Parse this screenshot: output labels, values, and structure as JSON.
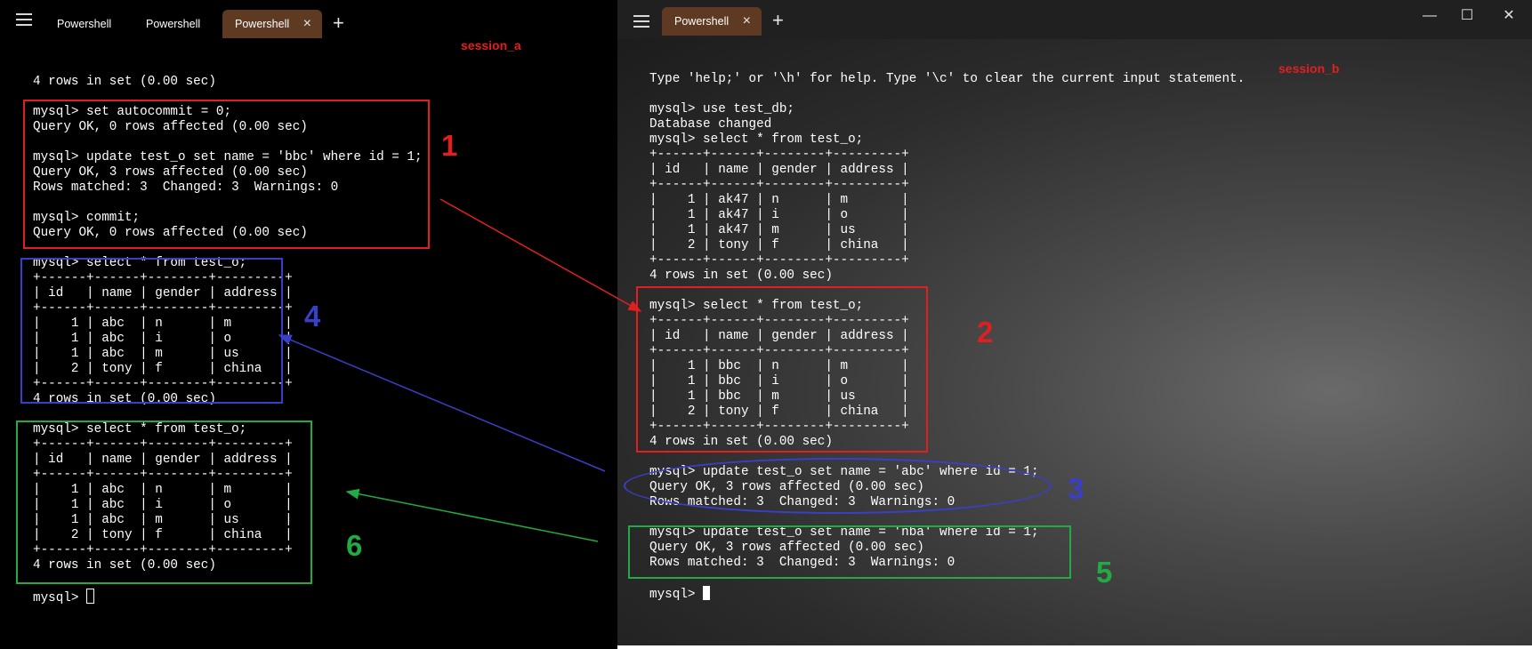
{
  "session_a": {
    "tabs": [
      {
        "label": "Powershell",
        "active": false
      },
      {
        "label": "Powershell",
        "active": false
      },
      {
        "label": "Powershell",
        "active": true
      }
    ],
    "tab_close_icon": "×",
    "new_tab_icon": "+",
    "session_label": "session_a",
    "terminal_lines": [
      "4 rows in set (0.00 sec)",
      "",
      "mysql> set autocommit = 0;",
      "Query OK, 0 rows affected (0.00 sec)",
      "",
      "mysql> update test_o set name = 'bbc' where id = 1;",
      "Query OK, 3 rows affected (0.00 sec)",
      "Rows matched: 3  Changed: 3  Warnings: 0",
      "",
      "mysql> commit;",
      "Query OK, 0 rows affected (0.00 sec)",
      "",
      "mysql> select * from test_o;",
      "+------+------+--------+---------+",
      "| id   | name | gender | address |",
      "+------+------+--------+---------+",
      "|    1 | abc  | n      | m       |",
      "|    1 | abc  | i      | o       |",
      "|    1 | abc  | m      | us      |",
      "|    2 | tony | f      | china   |",
      "+------+------+--------+---------+",
      "4 rows in set (0.00 sec)",
      "",
      "mysql> select * from test_o;",
      "+------+------+--------+---------+",
      "| id   | name | gender | address |",
      "+------+------+--------+---------+",
      "|    1 | abc  | n      | m       |",
      "|    1 | abc  | i      | o       |",
      "|    1 | abc  | m      | us      |",
      "|    2 | tony | f      | china   |",
      "+------+------+--------+---------+",
      "4 rows in set (0.00 sec)",
      "",
      "mysql> "
    ]
  },
  "session_b": {
    "tabs": [
      {
        "label": "Powershell",
        "active": true
      }
    ],
    "tab_close_icon": "×",
    "new_tab_icon": "+",
    "window_controls": {
      "minimize": "—",
      "maximize": "☐",
      "close": "✕"
    },
    "session_label": "session_b",
    "terminal_lines": [
      "Type 'help;' or '\\h' for help. Type '\\c' to clear the current input statement.",
      "",
      "mysql> use test_db;",
      "Database changed",
      "mysql> select * from test_o;",
      "+------+------+--------+---------+",
      "| id   | name | gender | address |",
      "+------+------+--------+---------+",
      "|    1 | ak47 | n      | m       |",
      "|    1 | ak47 | i      | o       |",
      "|    1 | ak47 | m      | us      |",
      "|    2 | tony | f      | china   |",
      "+------+------+--------+---------+",
      "4 rows in set (0.00 sec)",
      "",
      "mysql> select * from test_o;",
      "+------+------+--------+---------+",
      "| id   | name | gender | address |",
      "+------+------+--------+---------+",
      "|    1 | bbc  | n      | m       |",
      "|    1 | bbc  | i      | o       |",
      "|    1 | bbc  | m      | us      |",
      "|    2 | tony | f      | china   |",
      "+------+------+--------+---------+",
      "4 rows in set (0.00 sec)",
      "",
      "mysql> update test_o set name = 'abc' where id = 1;",
      "Query OK, 3 rows affected (0.00 sec)",
      "Rows matched: 3  Changed: 3  Warnings: 0",
      "",
      "mysql> update test_o set name = 'nba' where id = 1;",
      "Query OK, 3 rows affected (0.00 sec)",
      "Rows matched: 3  Changed: 3  Warnings: 0",
      "",
      "mysql> "
    ]
  },
  "annotations": [
    {
      "number": "1",
      "color": "#e02020"
    },
    {
      "number": "2",
      "color": "#e02020"
    },
    {
      "number": "3",
      "color": "#3a3fc8"
    },
    {
      "number": "4",
      "color": "#3a3fc8"
    },
    {
      "number": "5",
      "color": "#22aa44"
    },
    {
      "number": "6",
      "color": "#22aa44"
    }
  ],
  "colors": {
    "terminal_a_bg": "#000000",
    "terminal_b_bg": "#202020",
    "tab_active": "#5e3a22",
    "annotation_red": "#e02020",
    "annotation_blue": "#3a3fc8",
    "annotation_green": "#22aa44"
  }
}
